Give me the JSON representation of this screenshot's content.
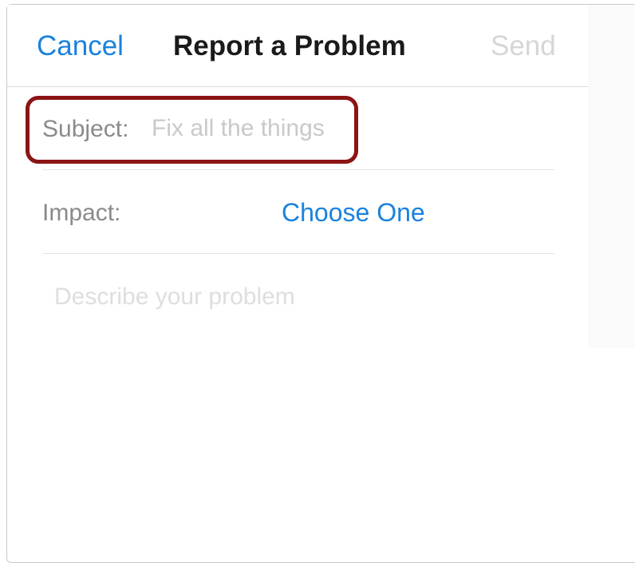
{
  "navbar": {
    "cancel_label": "Cancel",
    "title": "Report a Problem",
    "send_label": "Send"
  },
  "form": {
    "subject": {
      "label": "Subject:",
      "value": "",
      "placeholder": "Fix all the things"
    },
    "impact": {
      "label": "Impact:",
      "selected": "Choose One"
    },
    "description": {
      "value": "",
      "placeholder": "Describe your problem"
    }
  },
  "colors": {
    "accent": "#1a82dd",
    "highlight_border": "#8b1414",
    "disabled_text": "#d6d6d6",
    "label_text": "#8a8a8a"
  }
}
